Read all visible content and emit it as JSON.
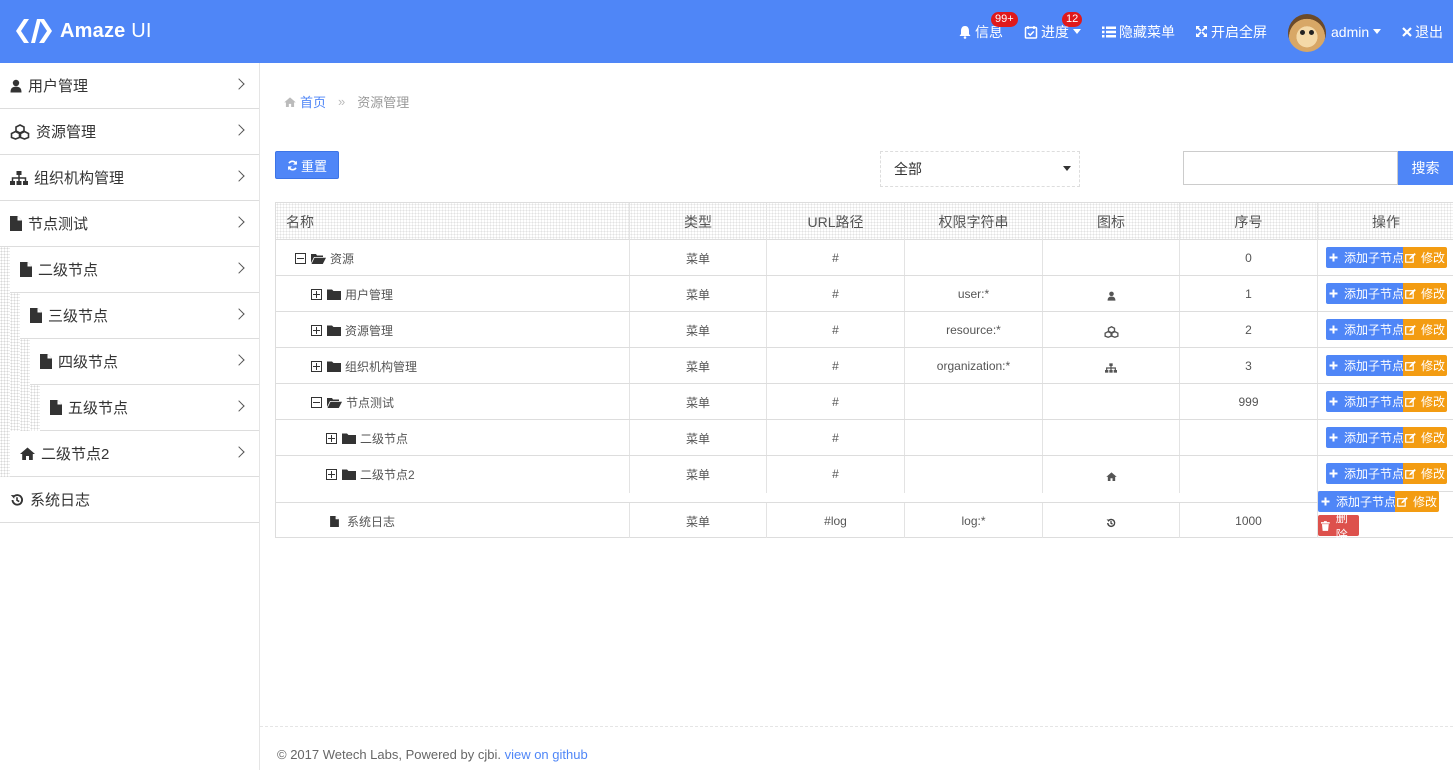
{
  "header": {
    "logo_bold": "Amaze",
    "logo_thin": " UI",
    "messages_label": "信息",
    "messages_badge": "99+",
    "progress_label": "进度",
    "progress_badge": "12",
    "hide_menu_label": "隐藏菜单",
    "fullscreen_label": "开启全屏",
    "user_label": "admin",
    "logout_label": "退出"
  },
  "sidebar": {
    "items": [
      {
        "label": "用户管理",
        "icon": "user-icon"
      },
      {
        "label": "资源管理",
        "icon": "cubes-icon"
      },
      {
        "label": "组织机构管理",
        "icon": "sitemap-icon"
      },
      {
        "label": "节点测试",
        "icon": "file-icon"
      },
      {
        "label": "二级节点",
        "icon": "file-icon"
      },
      {
        "label": "三级节点",
        "icon": "file-icon"
      },
      {
        "label": "四级节点",
        "icon": "file-icon"
      },
      {
        "label": "五级节点",
        "icon": "file-icon"
      },
      {
        "label": "二级节点2",
        "icon": "home-icon"
      },
      {
        "label": "系统日志",
        "icon": "history-icon"
      }
    ]
  },
  "breadcrumb": {
    "home": "首页",
    "separator": "»",
    "current": "资源管理"
  },
  "toolbar": {
    "reset_label": "重置",
    "filter_value": "全部",
    "search_value": "",
    "search_label": "搜索"
  },
  "table": {
    "headers": [
      "名称",
      "类型",
      "URL路径",
      "权限字符串",
      "图标",
      "序号",
      "操作"
    ],
    "rows": [
      {
        "name": "资源",
        "type": "菜单",
        "url": "#",
        "perm": "",
        "icon": "",
        "order": "0"
      },
      {
        "name": "用户管理",
        "type": "菜单",
        "url": "#",
        "perm": "user:*",
        "icon": "user-icon",
        "order": "1"
      },
      {
        "name": "资源管理",
        "type": "菜单",
        "url": "#",
        "perm": "resource:*",
        "icon": "cubes-icon",
        "order": "2"
      },
      {
        "name": "组织机构管理",
        "type": "菜单",
        "url": "#",
        "perm": "organization:*",
        "icon": "sitemap-icon",
        "order": "3"
      },
      {
        "name": "节点测试",
        "type": "菜单",
        "url": "#",
        "perm": "",
        "icon": "",
        "order": "999"
      },
      {
        "name": "二级节点",
        "type": "菜单",
        "url": "#",
        "perm": "",
        "icon": "",
        "order": ""
      },
      {
        "name": "二级节点2",
        "type": "菜单",
        "url": "#",
        "perm": "",
        "icon": "home-icon",
        "order": ""
      },
      {
        "name": "系统日志",
        "type": "菜单",
        "url": "#log",
        "perm": "log:*",
        "icon": "history-icon",
        "order": "1000"
      }
    ],
    "op_add": "添加子节点",
    "op_edit": "修改",
    "op_delete": "删除"
  },
  "footer": {
    "text": "© 2017 Wetech Labs, Powered by cjbi. ",
    "link": "view on github"
  },
  "colors": {
    "primary": "#4f86f7",
    "warning": "#f39c12",
    "danger": "#dd514c",
    "badge": "#e0191b"
  }
}
